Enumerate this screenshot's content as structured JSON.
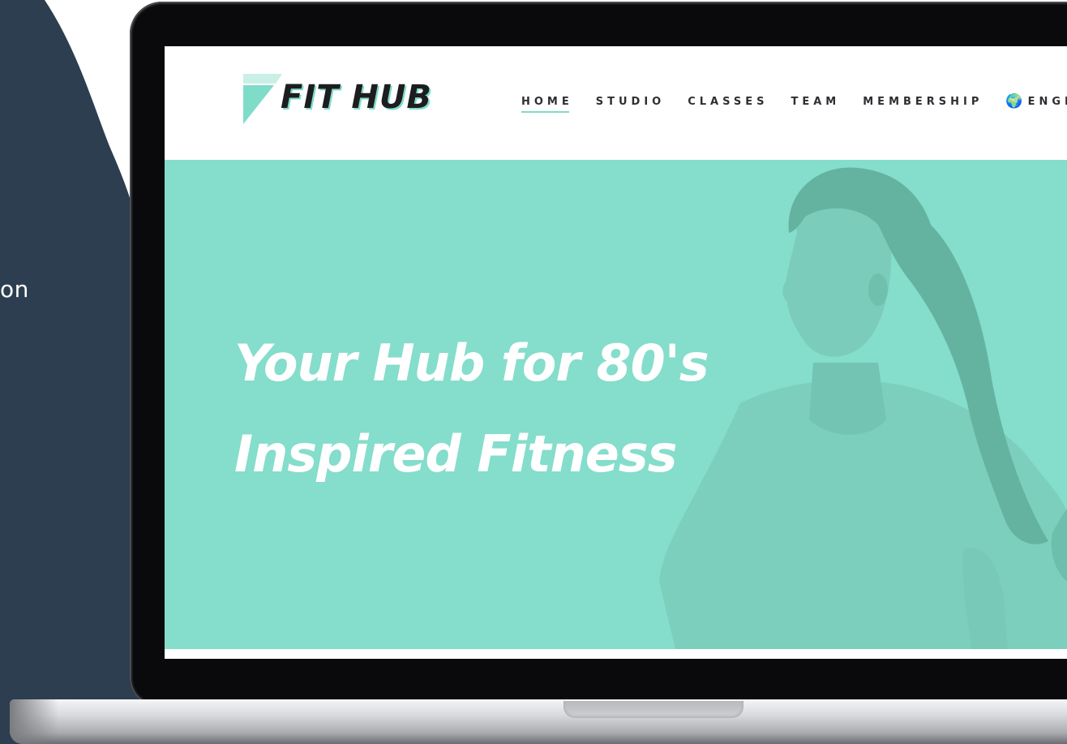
{
  "side_panel": {
    "text_fragment": "on",
    "color": "#2d3e50"
  },
  "site": {
    "logo_text": "FIT HUB",
    "nav": {
      "items": [
        {
          "label": "HOME",
          "active": true
        },
        {
          "label": "STUDIO",
          "active": false
        },
        {
          "label": "CLASSES",
          "active": false
        },
        {
          "label": "TEAM",
          "active": false
        },
        {
          "label": "MEMBERSHIP",
          "active": false
        }
      ],
      "language_label": "ENGL",
      "language_icon": "globe-icon"
    },
    "hero": {
      "title_line1": "Your Hub for 80's",
      "title_line2": "Inspired Fitness",
      "background_color": "#85ddcb"
    },
    "accent_color": "#7fdcc9"
  }
}
